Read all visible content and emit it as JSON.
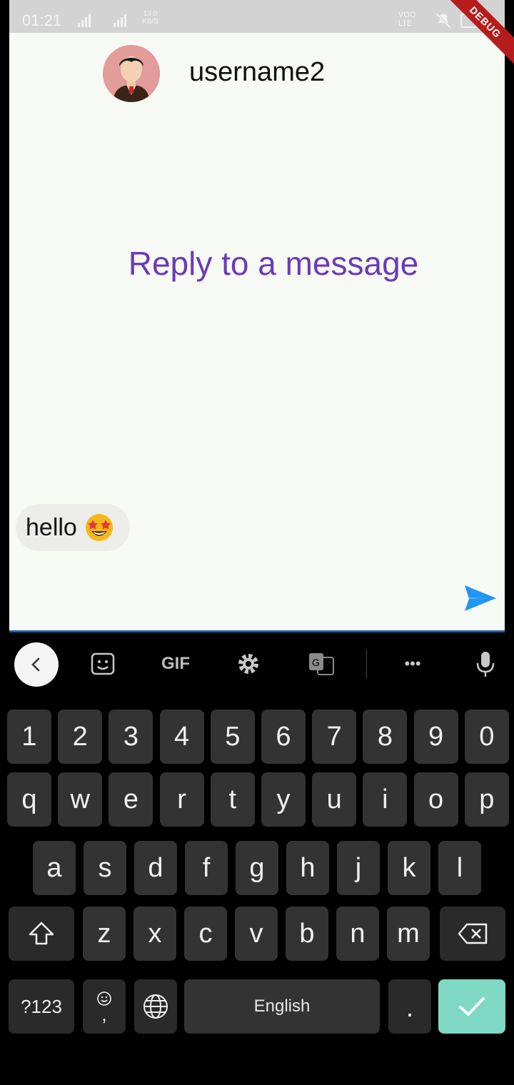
{
  "status": {
    "time": "01:21",
    "netspeed_value": "13.0",
    "netspeed_unit": "KB/S",
    "volte": "VOO\nLTE"
  },
  "debug_banner": "DEBUG",
  "chat": {
    "username": "username2",
    "empty_hint": "Reply to a message",
    "messages": [
      {
        "text": "hello",
        "emoji": "star-struck-emoji"
      }
    ]
  },
  "keyboard": {
    "toolbar": {
      "gif_label": "GIF",
      "more_label": "•••"
    },
    "rows": {
      "numbers": [
        "1",
        "2",
        "3",
        "4",
        "5",
        "6",
        "7",
        "8",
        "9",
        "0"
      ],
      "row1": [
        "q",
        "w",
        "e",
        "r",
        "t",
        "y",
        "u",
        "i",
        "o",
        "p"
      ],
      "row2": [
        "a",
        "s",
        "d",
        "f",
        "g",
        "h",
        "j",
        "k",
        "l"
      ],
      "row3": [
        "z",
        "x",
        "c",
        "v",
        "b",
        "n",
        "m"
      ]
    },
    "symbols_label": "?123",
    "comma_label": ",",
    "space_label": "English",
    "period_label": "."
  },
  "colors": {
    "accent": "#6a3bb8",
    "send": "#2196f3",
    "enter": "#7fd8c4",
    "underline": "#1f5fa8"
  }
}
